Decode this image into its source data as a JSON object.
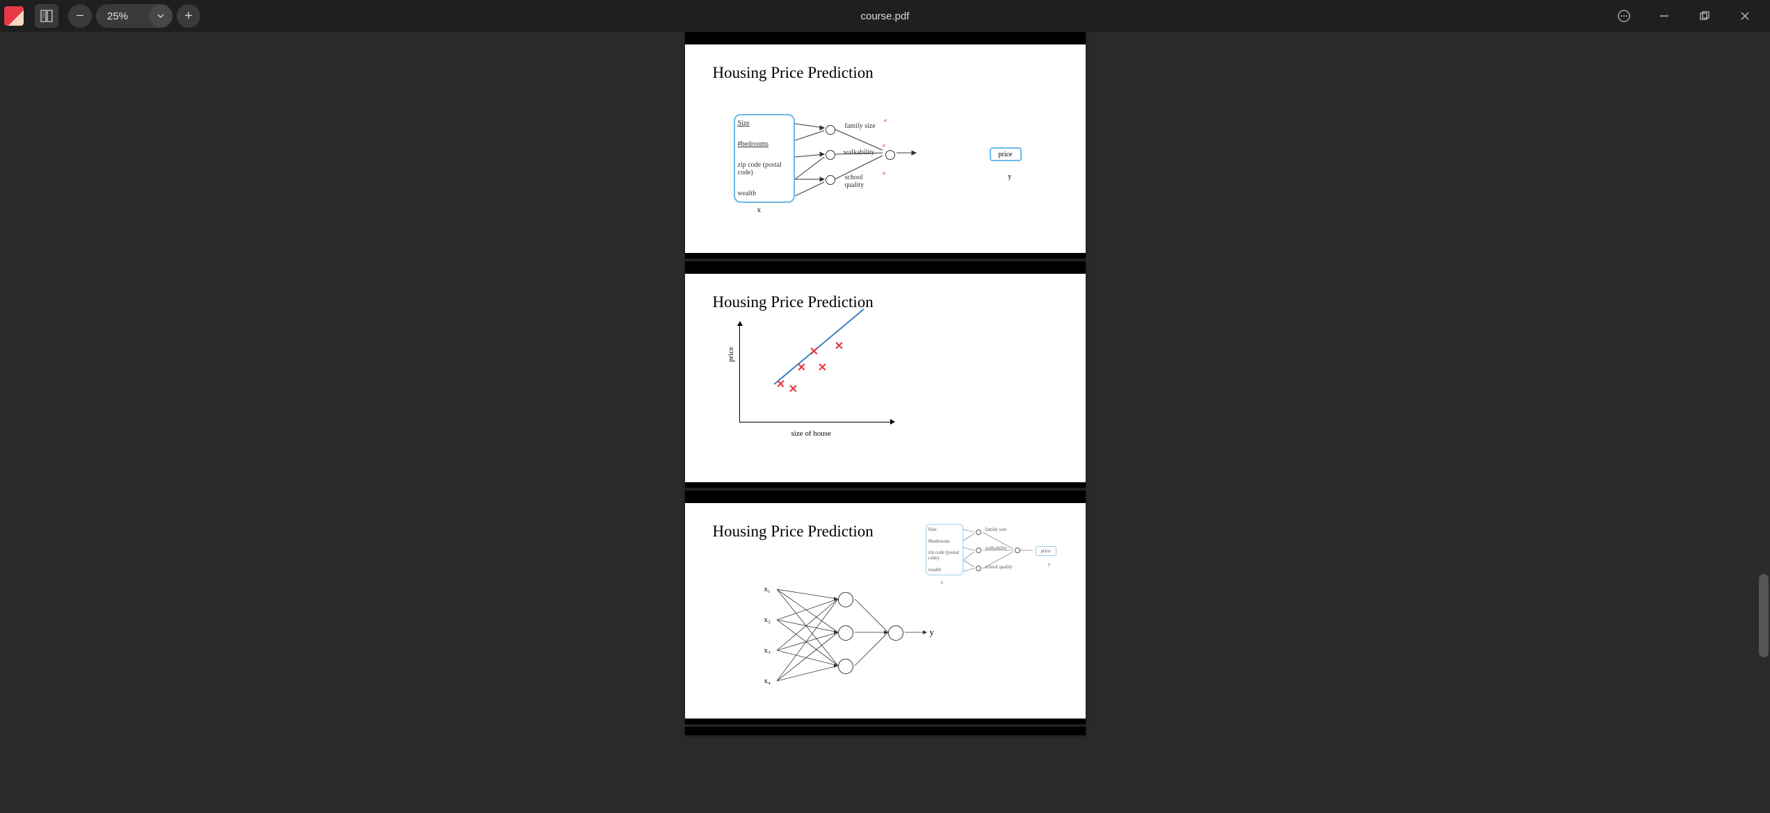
{
  "titlebar": {
    "document_title": "course.pdf",
    "zoom": {
      "minus_label": "−",
      "value": "25%",
      "plus_label": "+"
    },
    "icons": {
      "app": "app-icon",
      "toc": "toc-icon",
      "more": "more-icon",
      "minimize": "minimize-icon",
      "maximize": "maximize-icon",
      "close": "close-icon",
      "chevron": "chevron-down-icon"
    }
  },
  "pages": [
    {
      "title": "Housing Price Prediction",
      "inputs": [
        "Size",
        "#bedrooms",
        "zip code (postal code)",
        "wealth"
      ],
      "mid_features": [
        "family size",
        "walkability",
        "school quality"
      ],
      "output": "price",
      "x_label": "x",
      "y_label": "y"
    },
    {
      "title": "Housing Price Prediction"
    },
    {
      "title": "Housing Price Prediction",
      "mini_inputs": [
        "Size",
        "#bedrooms",
        "zip code (postal code)",
        "wealth"
      ],
      "mini_mids": [
        "family size",
        "walkability",
        "school quality"
      ],
      "mini_output": "price",
      "mini_x": "x",
      "mini_y": "y",
      "nn_inputs": [
        "x₁",
        "x₂",
        "x₃",
        "x₄"
      ],
      "nn_output": "y"
    }
  ],
  "chart_data": {
    "type": "scatter",
    "title": "",
    "xlabel": "size of house",
    "ylabel": "price",
    "fit_line": true,
    "points": [
      {
        "x": 1.0,
        "y": 1.4
      },
      {
        "x": 1.3,
        "y": 1.2
      },
      {
        "x": 1.5,
        "y": 2.0
      },
      {
        "x": 1.8,
        "y": 2.6
      },
      {
        "x": 2.0,
        "y": 2.0
      },
      {
        "x": 2.4,
        "y": 2.8
      }
    ],
    "xlim": [
      0,
      3.5
    ],
    "ylim": [
      0,
      3.5
    ]
  }
}
